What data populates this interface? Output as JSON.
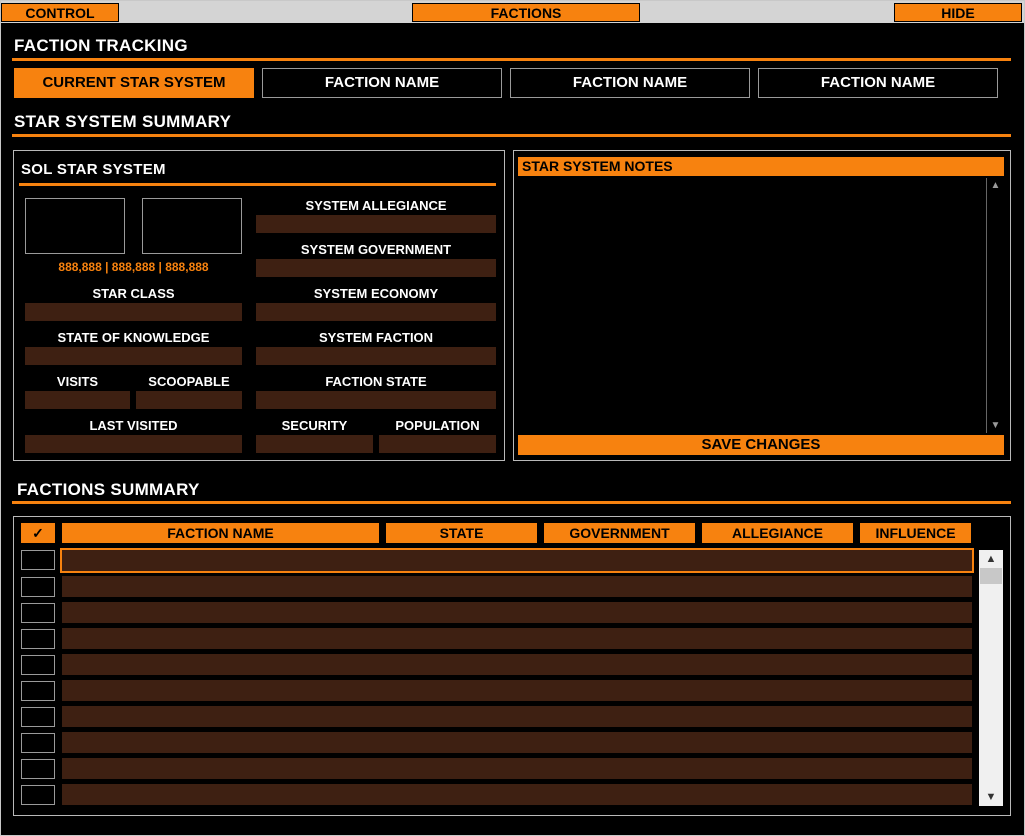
{
  "topbar": {
    "control": "CONTROL",
    "factions": "FACTIONS",
    "hide": "HIDE"
  },
  "faction_tracking": {
    "title": "FACTION TRACKING",
    "buttons": [
      "CURRENT STAR SYSTEM",
      "FACTION NAME",
      "FACTION NAME",
      "FACTION NAME"
    ]
  },
  "star_summary": {
    "title": "STAR SYSTEM SUMMARY",
    "system_name": "SOL STAR SYSTEM",
    "coords": "888,888 | 888,888 | 888,888",
    "labels": {
      "star_class": "STAR CLASS",
      "state_of_knowledge": "STATE OF KNOWLEDGE",
      "visits": "VISITS",
      "scoopable": "SCOOPABLE",
      "last_visited": "LAST VISITED",
      "allegiance": "SYSTEM ALLEGIANCE",
      "government": "SYSTEM GOVERNMENT",
      "economy": "SYSTEM ECONOMY",
      "faction": "SYSTEM FACTION",
      "faction_state": "FACTION STATE",
      "security": "SECURITY",
      "population": "POPULATION"
    },
    "notes_title": "STAR SYSTEM NOTES",
    "notes_text": "",
    "save_label": "SAVE CHANGES"
  },
  "factions_summary": {
    "title": "FACTIONS SUMMARY",
    "check_header": "✓",
    "columns": [
      "FACTION NAME",
      "STATE",
      "GOVERNMENT",
      "ALLEGIANCE",
      "INFLUENCE"
    ]
  },
  "colors": {
    "accent": "#f7820f",
    "field": "#3e2012",
    "background": "#000000"
  }
}
